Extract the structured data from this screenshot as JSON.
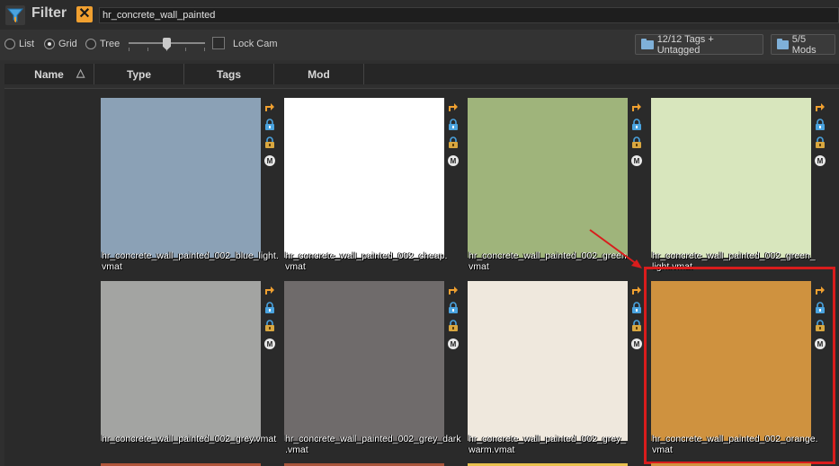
{
  "filter": {
    "label": "Filter",
    "clear_glyph": "✕",
    "value": "hr_concrete_wall_painted"
  },
  "view_options": {
    "list_label": "List",
    "grid_label": "Grid",
    "tree_label": "Tree",
    "selected": "Grid",
    "lock_cam_label": "Lock Cam",
    "lock_cam_checked": false,
    "tags_button": "12/12 Tags + Untagged",
    "mods_button": "5/5 Mods"
  },
  "columns": [
    {
      "label": "Name"
    },
    {
      "label": "Type"
    },
    {
      "label": "Tags"
    },
    {
      "label": "Mod"
    }
  ],
  "sort_indicator": "△",
  "colors": {
    "accent_orange": "#f0a030",
    "lock_blue": "#4aa3df",
    "highlight_red": "#d91c1c"
  },
  "tile_icons": [
    "open-in-editor-icon",
    "lock-icon",
    "lock-gold-icon",
    "mod-m-icon"
  ],
  "materials": [
    {
      "name": "hr_concrete_wall_painted_002_blue_light.vmat",
      "color": "#8ba1b6"
    },
    {
      "name": "hr_concrete_wall_painted_002_cheap.vmat",
      "color": "#ffffff"
    },
    {
      "name": "hr_concrete_wall_painted_002_green.vmat",
      "color": "#9fb47b"
    },
    {
      "name": "hr_concrete_wall_painted_002_green_light.vmat",
      "color": "#d8e6bd"
    },
    {
      "name": "hr_concrete_wall_painted_002_grey.vmat",
      "color": "#a3a4a2"
    },
    {
      "name": "hr_concrete_wall_painted_002_grey_dark.vmat",
      "color": "#6f6b6b"
    },
    {
      "name": "hr_concrete_wall_painted_002_grey_warm.vmat",
      "color": "#efe8dd"
    },
    {
      "name": "hr_concrete_wall_painted_002_orange.vmat",
      "color": "#cf923f"
    }
  ],
  "caption_lines": [
    [
      "hr_concrete_wall_painted_002_blue_light.",
      "vmat"
    ],
    [
      "hr_concrete_wall_painted_002_cheap.",
      "vmat"
    ],
    [
      "hr_concrete_wall_painted_002_green.",
      "vmat"
    ],
    [
      "hr_concrete_wall_painted_002_green_",
      "light.vmat"
    ],
    [
      "hr_concrete_wall_painted_002_grey.vmat",
      ""
    ],
    [
      "hr_concrete_wall_painted_002_grey_dark",
      ".vmat"
    ],
    [
      "hr_concrete_wall_painted_002_grey_",
      "warm.vmat"
    ],
    [
      "hr_concrete_wall_painted_002_orange.",
      "vmat"
    ]
  ],
  "selected_material": "hr_concrete_wall_painted_002_orange.vmat",
  "partial_row_colors": [
    "#b0553a",
    "#a9553b",
    "#e8c04e",
    "#cf923f"
  ]
}
